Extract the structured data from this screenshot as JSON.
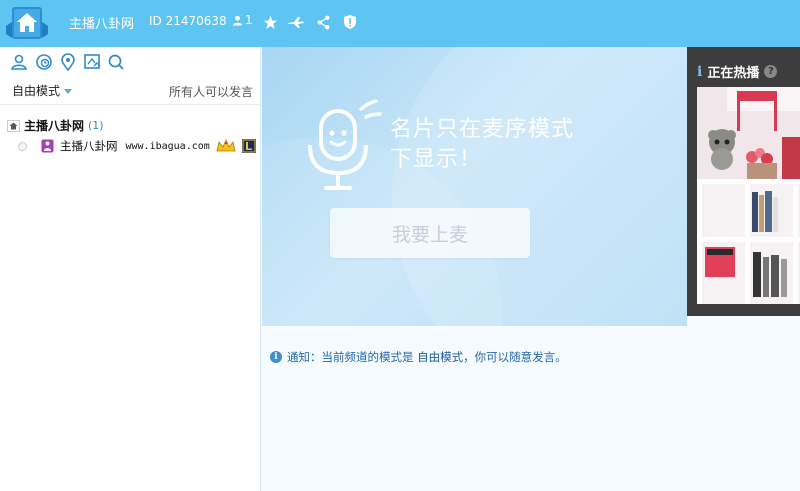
{
  "header": {
    "channel_title": "主播八卦网",
    "channel_id": "ID 21470638",
    "online_count": "1",
    "icons": [
      "home-logo-icon",
      "user-icon",
      "star-icon",
      "plane-icon",
      "share-icon",
      "shield-icon"
    ],
    "color": "#5ec4f1"
  },
  "left_toolbar": {
    "icons": [
      "members-icon",
      "history-icon",
      "location-icon",
      "upload-icon",
      "search-icon"
    ]
  },
  "mode": {
    "selected": "自由模式",
    "right_text": "所有人可以发言"
  },
  "tree": {
    "root_name": "主播八卦网",
    "root_count": "(1)",
    "users": [
      {
        "name": "主播八卦网",
        "site": "www.ibagua.com"
      }
    ]
  },
  "stage": {
    "message": "名片只在麦序模式下显示！",
    "join_button": "我要上麦"
  },
  "hot": {
    "icon": "i",
    "title": "正在热播",
    "help": "?"
  },
  "chat": {
    "notice_prefix": "通知：当前频道的模式是 ",
    "notice_mode": "自由模式",
    "notice_suffix": "，你可以随意发言。"
  }
}
